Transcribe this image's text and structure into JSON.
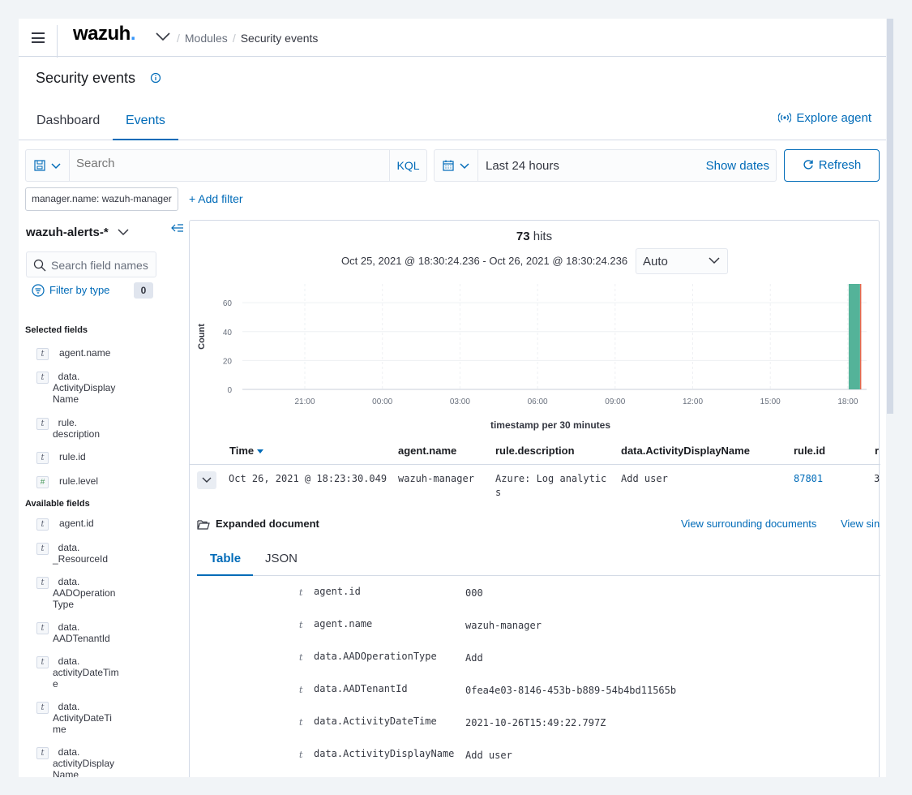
{
  "header": {
    "logo": "wazuh",
    "breadcrumbs": [
      "Modules",
      "Security events"
    ]
  },
  "page": {
    "title": "Security events"
  },
  "tabs": [
    {
      "label": "Dashboard",
      "active": false
    },
    {
      "label": "Events",
      "active": true
    }
  ],
  "explore_agent": "Explore agent",
  "search": {
    "placeholder": "Search",
    "language": "KQL"
  },
  "date_picker": {
    "range": "Last 24 hours",
    "show_dates": "Show dates"
  },
  "refresh_label": "Refresh",
  "filters": {
    "pill": "manager.name: wazuh-manager",
    "add": "+ Add filter"
  },
  "sidebar": {
    "index_pattern": "wazuh-alerts-*",
    "field_search_placeholder": "Search field names",
    "filter_by_type": "Filter by type",
    "filter_count": "0",
    "selected_heading": "Selected fields",
    "selected_fields": [
      {
        "type": "t",
        "name": "agent.name"
      },
      {
        "type": "t",
        "name": "data.\nActivityDisplay\nName"
      },
      {
        "type": "t",
        "name": "rule.\ndescription"
      },
      {
        "type": "t",
        "name": "rule.id"
      },
      {
        "type": "#",
        "name": "rule.level"
      }
    ],
    "available_heading": "Available fields",
    "available_fields": [
      {
        "type": "t",
        "name": "agent.id"
      },
      {
        "type": "t",
        "name": "data.\n_ResourceId"
      },
      {
        "type": "t",
        "name": "data.\nAADOperation\nType"
      },
      {
        "type": "t",
        "name": "data.\nAADTenantId"
      },
      {
        "type": "t",
        "name": "data.\nactivityDateTim\ne"
      },
      {
        "type": "t",
        "name": "data.\nActivityDateTi\nme"
      },
      {
        "type": "t",
        "name": "data.\nactivityDisplay\nName"
      }
    ]
  },
  "histogram": {
    "hits_count": "73",
    "hits_label": "hits",
    "interval": "Oct 25, 2021 @ 18:30:24.236 - Oct 26, 2021 @ 18:30:24.236",
    "interval_select": "Auto"
  },
  "chart_data": {
    "type": "bar",
    "x": [
      "21:00",
      "00:00",
      "03:00",
      "06:00",
      "09:00",
      "12:00",
      "15:00",
      "18:00"
    ],
    "ylabel": "Count",
    "xlabel": "timestamp per 30 minutes",
    "yticks": [
      0,
      20,
      40,
      60
    ],
    "ylim": [
      0,
      73
    ],
    "series": [
      {
        "x": "18:00",
        "value": 73,
        "color": "#54b399"
      }
    ],
    "grid": true
  },
  "table": {
    "columns": [
      "Time",
      "agent.name",
      "rule.description",
      "data.ActivityDisplayName",
      "rule.id",
      "r"
    ],
    "row": {
      "time": "Oct 26, 2021 @ 18:23:30.049",
      "agent_name": "wazuh-manager",
      "description_1": "Azure: Log analytic",
      "description_2": "s",
      "activity": "Add user",
      "rule_id": "87801",
      "rule_level": "3"
    }
  },
  "expanded": {
    "title": "Expanded document",
    "surrounding": "View surrounding documents",
    "single": "View sin",
    "tabs": [
      "Table",
      "JSON"
    ],
    "fields": [
      {
        "type": "t",
        "key": "agent.id",
        "value": "000"
      },
      {
        "type": "t",
        "key": "agent.name",
        "value": "wazuh-manager"
      },
      {
        "type": "t",
        "key": "data.AADOperationType",
        "value": "Add"
      },
      {
        "type": "t",
        "key": "data.AADTenantId",
        "value": "0fea4e03-8146-453b-b889-54b4bd11565b"
      },
      {
        "type": "t",
        "key": "data.ActivityDateTime",
        "value": "2021-10-26T15:49:22.797Z"
      },
      {
        "type": "t",
        "key": "data.ActivityDisplayName",
        "value": "Add user"
      }
    ]
  },
  "colors": {
    "accent": "#006bb8",
    "bar": "#54b399",
    "bar_edge": "#e7664c"
  }
}
